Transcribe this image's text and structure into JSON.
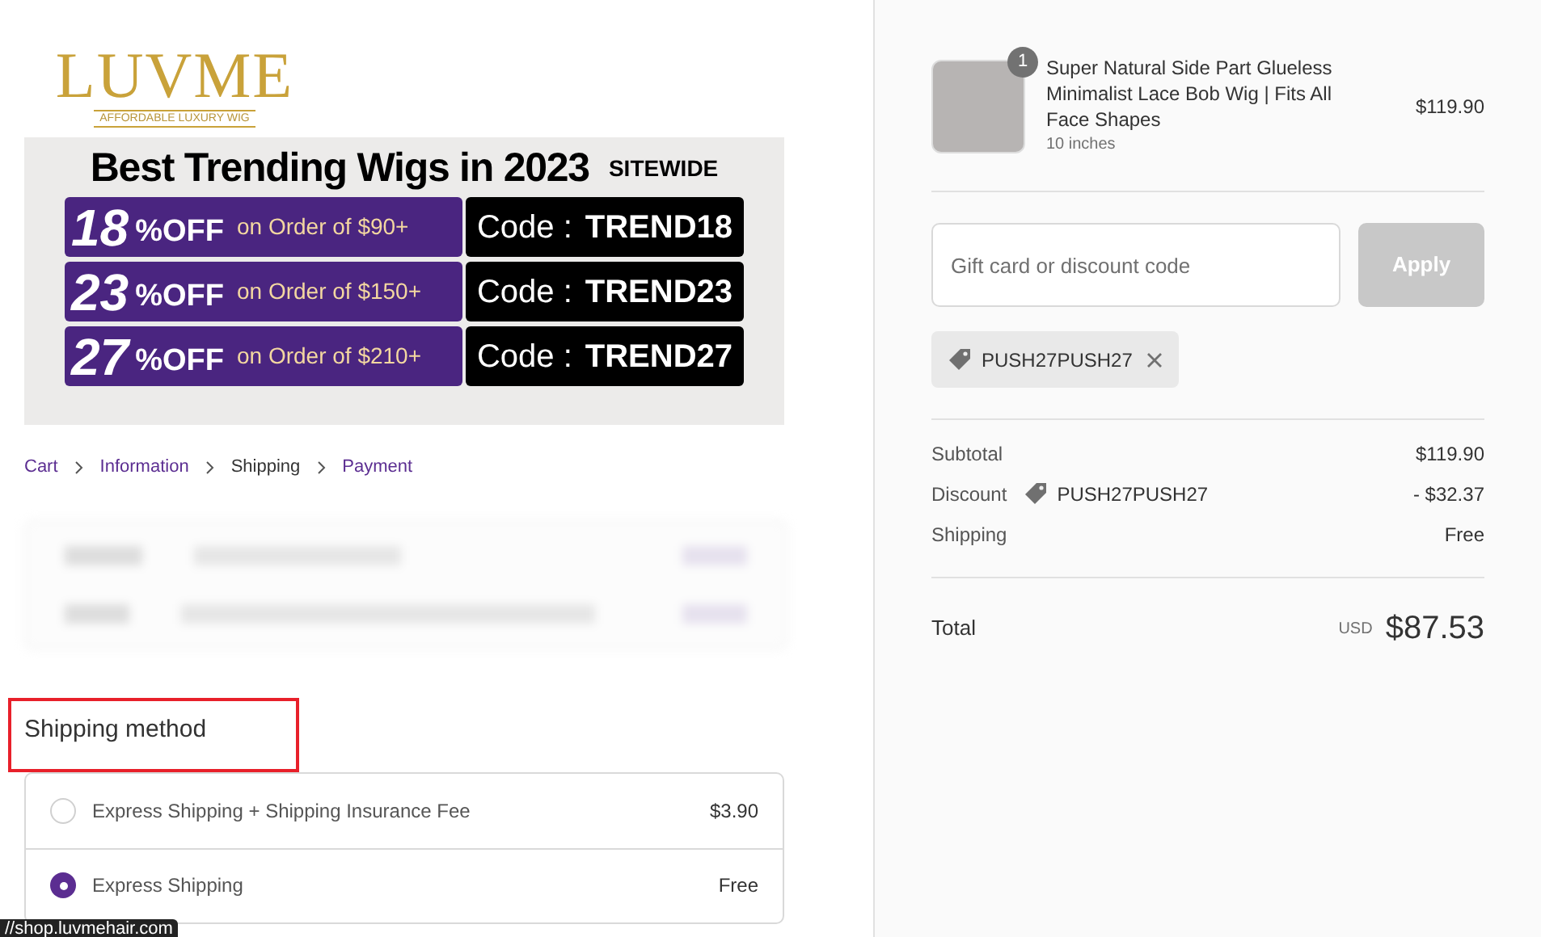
{
  "logo": {
    "wordmark": "LUVME",
    "tagline": "AFFORDABLE LUXURY WIG"
  },
  "banner": {
    "title": "Best Trending Wigs in 2023",
    "badge": "SITEWIDE",
    "offers": [
      {
        "percent": "18",
        "off": "%OFF",
        "condition": "on Order of $90+",
        "code_label": "Code :",
        "code": "TREND18"
      },
      {
        "percent": "23",
        "off": "%OFF",
        "condition": "on Order of $150+",
        "code_label": "Code :",
        "code": "TREND23"
      },
      {
        "percent": "27",
        "off": "%OFF",
        "condition": "on Order of $210+",
        "code_label": "Code :",
        "code": "TREND27"
      }
    ]
  },
  "breadcrumb": [
    {
      "label": "Cart",
      "selected": false
    },
    {
      "label": "Information",
      "selected": false
    },
    {
      "label": "Shipping",
      "selected": true
    },
    {
      "label": "Payment",
      "selected": false
    }
  ],
  "shipping_method": {
    "title": "Shipping method",
    "options": [
      {
        "label": "Express Shipping + Shipping Insurance Fee",
        "price": "$3.90",
        "selected": false
      },
      {
        "label": "Express Shipping",
        "price": "Free",
        "selected": true
      }
    ]
  },
  "status_url": "//shop.luvmehair.com",
  "order": {
    "item": {
      "quantity": "1",
      "name": "Super Natural Side Part Glueless Minimalist Lace Bob Wig | Fits All Face Shapes",
      "variant": "10 inches",
      "price": "$119.90"
    },
    "discount_field": {
      "placeholder": "Gift card or discount code"
    },
    "apply_button": "Apply",
    "applied_code": "PUSH27PUSH27",
    "summary": [
      {
        "label": "Subtotal",
        "value": "$119.90"
      },
      {
        "label": "Discount",
        "code": "PUSH27PUSH27",
        "value": "- $32.37"
      },
      {
        "label": "Shipping",
        "value": "Free"
      }
    ],
    "total": {
      "label": "Total",
      "currency": "USD",
      "value": "$87.53"
    }
  }
}
